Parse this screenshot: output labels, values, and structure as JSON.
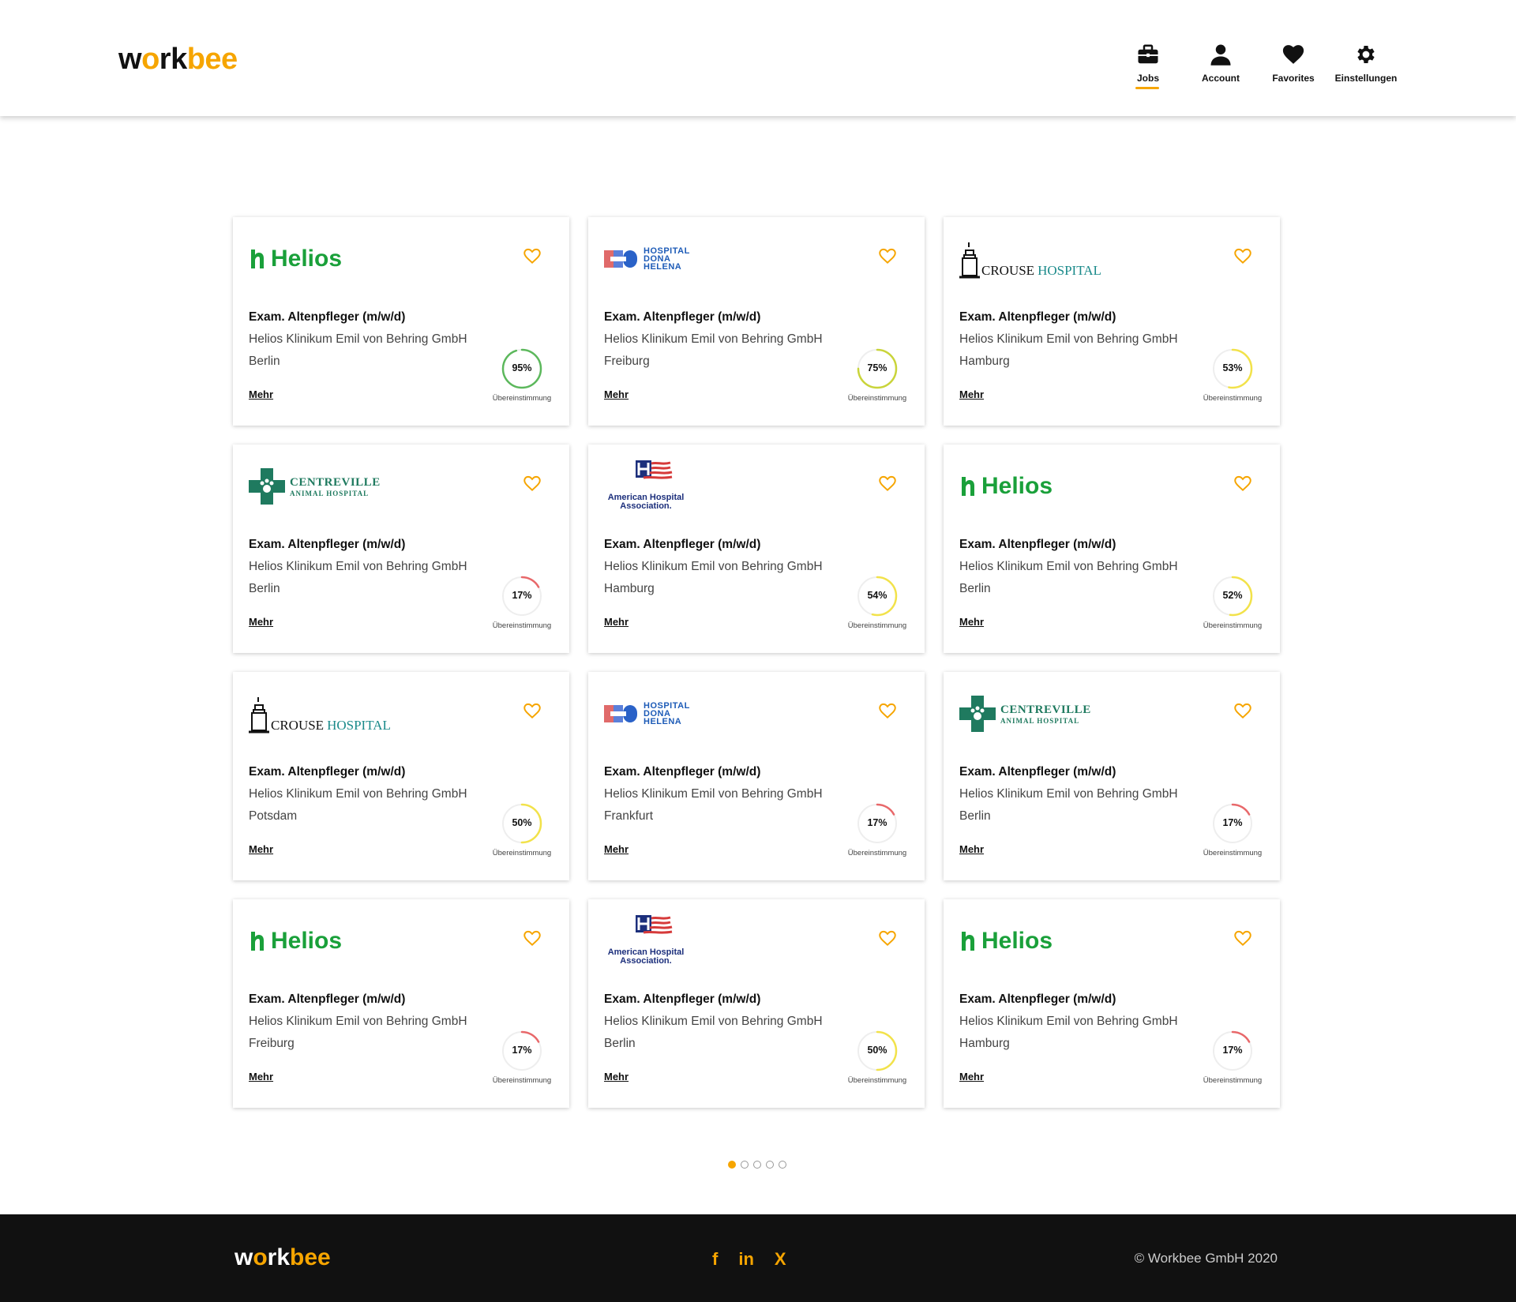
{
  "header": {
    "logo_w": "w",
    "logo_o": "o",
    "logo_rk": "rk",
    "logo_bee": "bee",
    "nav": [
      {
        "label": "Jobs",
        "icon": "briefcase-icon",
        "active": true
      },
      {
        "label": "Account",
        "icon": "user-icon",
        "active": false
      },
      {
        "label": "Favorites",
        "icon": "heart-icon",
        "active": false
      },
      {
        "label": "Einstellungen",
        "icon": "gear-icon",
        "active": false
      }
    ]
  },
  "cards": [
    {
      "logo": "Helios",
      "title": "Exam. Altenpfleger (m/w/d)",
      "company": "Helios Klinikum Emil von Behring GmbH",
      "city": "Berlin",
      "more": "Mehr",
      "match": 95,
      "match_label": "Übereinstimmung",
      "color": "#5cb85c"
    },
    {
      "logo": "HOSPITAL DONA HELENA",
      "title": "Exam. Altenpfleger (m/w/d)",
      "company": "Helios Klinikum Emil von Behring GmbH",
      "city": "Freiburg",
      "more": "Mehr",
      "match": 75,
      "match_label": "Übereinstimmung",
      "color": "#c9d43a"
    },
    {
      "logo": "CROUSE HOSPITAL",
      "title": "Exam. Altenpfleger (m/w/d)",
      "company": "Helios Klinikum Emil von Behring GmbH",
      "city": "Hamburg",
      "more": "Mehr",
      "match": 53,
      "match_label": "Übereinstimmung",
      "color": "#f2e24a"
    },
    {
      "logo": "CENTREVILLE ANIMAL HOSPITAL",
      "title": "Exam. Altenpfleger (m/w/d)",
      "company": "Helios Klinikum Emil von Behring GmbH",
      "city": "Berlin",
      "more": "Mehr",
      "match": 17,
      "match_label": "Übereinstimmung",
      "color": "#e8686a"
    },
    {
      "logo": "American Hospital Association",
      "title": "Exam. Altenpfleger (m/w/d)",
      "company": "Helios Klinikum Emil von Behring GmbH",
      "city": "Hamburg",
      "more": "Mehr",
      "match": 54,
      "match_label": "Übereinstimmung",
      "color": "#f2e24a"
    },
    {
      "logo": "Helios",
      "title": "Exam. Altenpfleger (m/w/d)",
      "company": "Helios Klinikum Emil von Behring GmbH",
      "city": "Berlin",
      "more": "Mehr",
      "match": 52,
      "match_label": "Übereinstimmung",
      "color": "#f2e24a"
    },
    {
      "logo": "CROUSE HOSPITAL",
      "title": "Exam. Altenpfleger (m/w/d)",
      "company": "Helios Klinikum Emil von Behring GmbH",
      "city": "Potsdam",
      "more": "Mehr",
      "match": 50,
      "match_label": "Übereinstimmung",
      "color": "#f2e24a"
    },
    {
      "logo": "HOSPITAL DONA HELENA",
      "title": "Exam. Altenpfleger (m/w/d)",
      "company": "Helios Klinikum Emil von Behring GmbH",
      "city": "Frankfurt",
      "more": "Mehr",
      "match": 17,
      "match_label": "Übereinstimmung",
      "color": "#e8686a"
    },
    {
      "logo": "CENTREVILLE ANIMAL HOSPITAL",
      "title": "Exam. Altenpfleger (m/w/d)",
      "company": "Helios Klinikum Emil von Behring GmbH",
      "city": "Berlin",
      "more": "Mehr",
      "match": 17,
      "match_label": "Übereinstimmung",
      "color": "#e8686a"
    },
    {
      "logo": "Helios",
      "title": "Exam. Altenpfleger (m/w/d)",
      "company": "Helios Klinikum Emil von Behring GmbH",
      "city": "Freiburg",
      "more": "Mehr",
      "match": 17,
      "match_label": "Übereinstimmung",
      "color": "#e8686a"
    },
    {
      "logo": "American Hospital Association",
      "title": "Exam. Altenpfleger (m/w/d)",
      "company": "Helios Klinikum Emil von Behring GmbH",
      "city": "Berlin",
      "more": "Mehr",
      "match": 50,
      "match_label": "Übereinstimmung",
      "color": "#f2e24a"
    },
    {
      "logo": "Helios",
      "title": "Exam. Altenpfleger (m/w/d)",
      "company": "Helios Klinikum Emil von Behring GmbH",
      "city": "Hamburg",
      "more": "Mehr",
      "match": 17,
      "match_label": "Übereinstimmung",
      "color": "#e8686a"
    }
  ],
  "pagination": {
    "pages": 5,
    "current": 1
  },
  "footer": {
    "logo_w": "w",
    "logo_o": "o",
    "logo_rk": "rk",
    "logo_bee": "bee",
    "social": [
      "f",
      "in",
      "X"
    ],
    "copyright": "©  Workbee GmbH 2020"
  },
  "colors": {
    "accent": "#f6a500",
    "footer_bg": "#111111"
  }
}
